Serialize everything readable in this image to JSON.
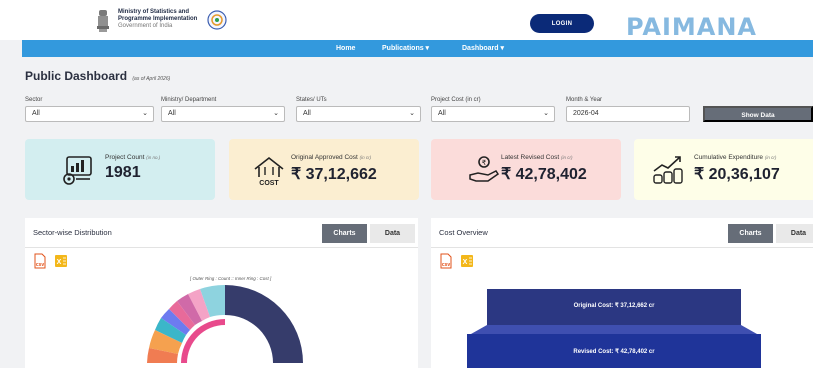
{
  "header": {
    "ministry_line1": "Ministry of Statistics and",
    "ministry_line2": "Programme Implementation",
    "ministry_line3": "Government of India",
    "login_label": "LOGIN",
    "brand_name": "PAIMANA"
  },
  "nav": {
    "items": [
      {
        "label": "Home"
      },
      {
        "label": "Publications ▾"
      },
      {
        "label": "Dashboard ▾"
      }
    ]
  },
  "page": {
    "title": "Public Dashboard",
    "as_of": "(as of April 2026)"
  },
  "filters": {
    "sector": {
      "label": "Sector",
      "value": "All"
    },
    "ministry": {
      "label": "Ministry/ Department",
      "value": "All"
    },
    "states": {
      "label": "States/ UTs",
      "value": "All"
    },
    "cost": {
      "label": "Project Cost (in cr)",
      "value": "All"
    },
    "month": {
      "label": "Month & Year",
      "value": "2026-04"
    },
    "show_button": "Show Data"
  },
  "cards": [
    {
      "label": "Project Count",
      "unit": "(in no.)",
      "value": "1981",
      "color": "#d3eef0"
    },
    {
      "label": "Original Approved Cost",
      "unit": "(in cr)",
      "value": "₹ 37,12,662",
      "color": "#fbeed1",
      "icon_text": "COST"
    },
    {
      "label": "Latest Revised Cost",
      "unit": "(in cr)",
      "value": "₹ 42,78,402",
      "color": "#fbdcda"
    },
    {
      "label": "Cumulative Expenditure",
      "unit": "(in cr)",
      "value": "₹ 20,36,107",
      "color": "#fefee8"
    }
  ],
  "panels": {
    "sector": {
      "title": "Sector-wise Distribution",
      "tab_charts": "Charts",
      "tab_data": "Data",
      "chart_note": "[ Outer Ring : Count :: Inner Ring : Cost ]"
    },
    "cost": {
      "title": "Cost Overview",
      "tab_charts": "Charts",
      "tab_data": "Data",
      "original_label": "Original Cost: ₹ 37,12,662 cr",
      "revised_label": "Revised Cost: ₹ 42,78,402 cr"
    }
  },
  "icons": {
    "download_csv": "csv-file-icon",
    "download_excel": "excel-file-icon"
  },
  "colors": {
    "nav_blue": "#3399dd",
    "login_navy": "#0b2a78",
    "button_gray": "#666d78",
    "bar_navy": "#2b3782",
    "bar_blue": "#1f3499"
  }
}
